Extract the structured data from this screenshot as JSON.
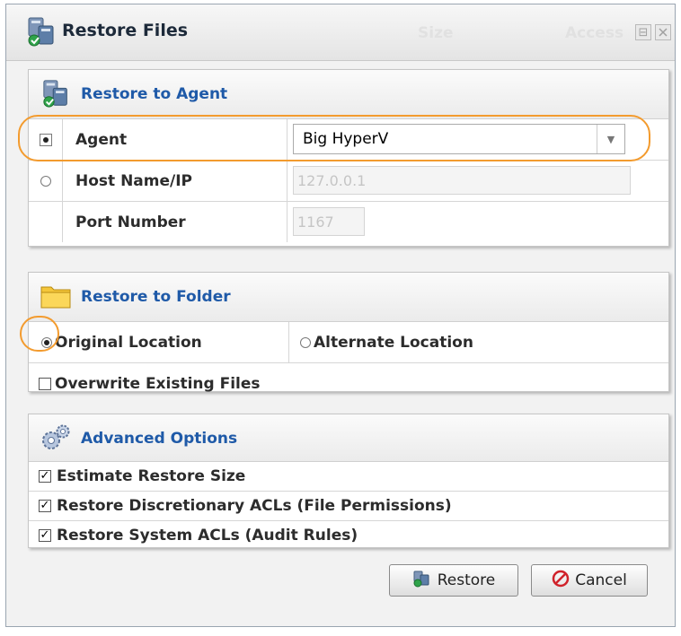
{
  "window": {
    "title": "Restore Files",
    "bg_size_label": "Size",
    "bg_access_label": "Access",
    "restore_button_icon": "⊟"
  },
  "agent_panel": {
    "title": "Restore to Agent",
    "agent_label": "Agent",
    "agent_selected": "Big HyperV",
    "host_label": "Host Name/IP",
    "host_value": "127.0.0.1",
    "port_label": "Port Number",
    "port_value": "1167"
  },
  "folder_panel": {
    "title": "Restore to Folder",
    "original_label": "Original Location",
    "alternate_label": "Alternate Location",
    "overwrite_label": "Overwrite Existing Files"
  },
  "advanced_panel": {
    "title": "Advanced Options",
    "options": [
      {
        "label": "Estimate Restore Size",
        "checked": true
      },
      {
        "label": "Restore Discretionary ACLs (File Permissions)",
        "checked": true
      },
      {
        "label": "Restore System ACLs (Audit Rules)",
        "checked": true
      }
    ]
  },
  "buttons": {
    "restore": "Restore",
    "cancel": "Cancel"
  },
  "colors": {
    "accent_title": "#1f5aa8",
    "highlight": "#f39b2e",
    "cancel_icon": "#d0222a"
  }
}
